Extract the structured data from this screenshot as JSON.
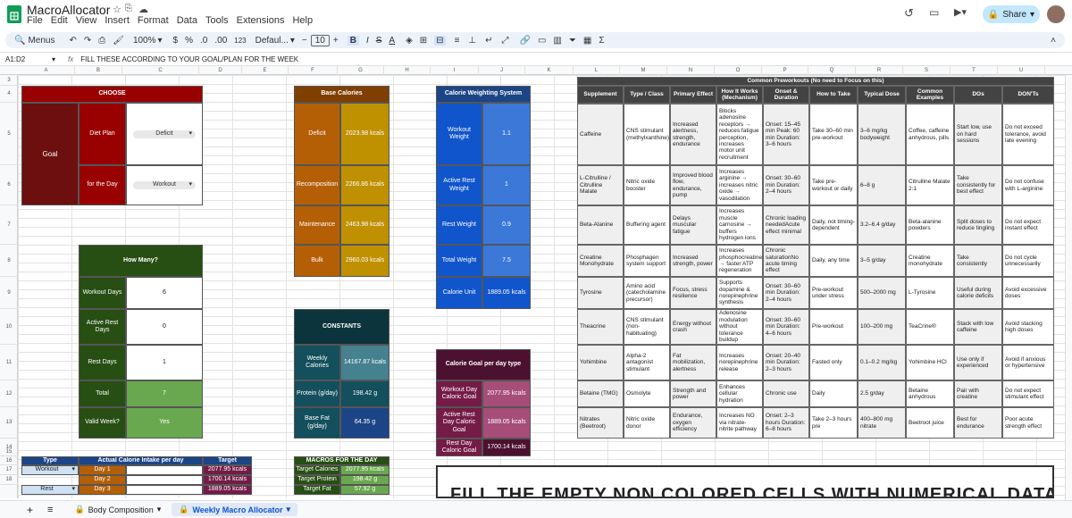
{
  "app": {
    "title": "MacroAllocator",
    "menus": [
      "File",
      "Edit",
      "View",
      "Insert",
      "Format",
      "Data",
      "Tools",
      "Extensions",
      "Help"
    ],
    "share": "Share"
  },
  "toolbar": {
    "menus_label": "Menus",
    "zoom": "100%",
    "currency": "$",
    "percent": "%",
    "dec_dec": ".0",
    "dec_inc": ".00",
    "num_fmt": "123",
    "font": "Defaul...",
    "font_size": "10"
  },
  "formula": {
    "cell_ref": "A1:D2",
    "fx": "fx",
    "content": "FILL THESE ACCORDING TO YOUR GOAL/PLAN FOR THE WEEK"
  },
  "columns": [
    "A",
    "B",
    "C",
    "D",
    "E",
    "F",
    "G",
    "H",
    "I",
    "J",
    "K",
    "L",
    "M",
    "N",
    "O",
    "P",
    "Q",
    "R",
    "S",
    "T",
    "U"
  ],
  "rows": [
    "3",
    "4",
    "5",
    "6",
    "7",
    "8",
    "9",
    "10",
    "11",
    "12",
    "13",
    "14",
    "15",
    "16",
    "17",
    "18"
  ],
  "choose": {
    "header": "CHOOSE",
    "goal": "Goal",
    "diet_plan": "Diet Plan",
    "diet_value": "Deficit",
    "for_day": "for the Day",
    "day_value": "Workout"
  },
  "howmany": {
    "header": "How Many?",
    "rows": [
      {
        "label": "Workout Days",
        "value": "6"
      },
      {
        "label": "Active Rest Days",
        "value": "0"
      },
      {
        "label": "Rest Days",
        "value": "1"
      },
      {
        "label": "Total",
        "value": "7"
      },
      {
        "label": "Valid Week?",
        "value": "Yes"
      }
    ]
  },
  "base": {
    "header": "Base Calories",
    "rows": [
      {
        "label": "Deficit",
        "value": "2023.98 kcals"
      },
      {
        "label": "Recomposition",
        "value": "2266.86 kcals"
      },
      {
        "label": "Maintenance",
        "value": "2463.98 kcals"
      },
      {
        "label": "Bulk",
        "value": "2960.03 kcals"
      }
    ]
  },
  "weighting": {
    "header": "Calorie Weighting System",
    "rows": [
      {
        "label": "Workout Weight",
        "value": "1.1"
      },
      {
        "label": "Active Rest Weight",
        "value": "1"
      },
      {
        "label": "Rest Weight",
        "value": "0.9"
      },
      {
        "label": "Total Weight",
        "value": "7.5"
      },
      {
        "label": "Calorie Unit",
        "value": "1889.05 kcals"
      }
    ]
  },
  "constants": {
    "header": "CONSTANTS",
    "rows": [
      {
        "label": "Weekly Calories",
        "value": "14167.87 kcals"
      },
      {
        "label": "Protein (g/day)",
        "value": "198.42 g"
      },
      {
        "label": "Base Fat (g/day)",
        "value": "64.35 g"
      }
    ]
  },
  "goal_per_day": {
    "header": "Calorie Goal per day type",
    "rows": [
      {
        "label": "Workout Day Caloric Goal",
        "value": "2077.95 kcals"
      },
      {
        "label": "Active Rest Day Caloric Goal",
        "value": "1889.05 kcals"
      },
      {
        "label": "Rest Day Caloric Goal",
        "value": "1700.14 kcals"
      }
    ]
  },
  "intake": {
    "headers": [
      "Type",
      "Actual Calorie Intake per day",
      "Target"
    ],
    "rows": [
      {
        "type": "Workout",
        "day": "Day 1",
        "target": "2077.95 kcals"
      },
      {
        "type": "Rest",
        "day": "Day 2",
        "target": "1700.14 kcals"
      },
      {
        "type": "Active Rest",
        "day": "Day 3",
        "target": "1889.05 kcals"
      }
    ]
  },
  "macros": {
    "header": "MACROS FOR THE DAY",
    "rows": [
      {
        "label": "Target Calories",
        "value": "2077.95 kcals"
      },
      {
        "label": "Target Protein",
        "value": "198.42 g"
      },
      {
        "label": "Target Fat",
        "value": "57.92 g"
      }
    ]
  },
  "preworkout": {
    "title": "Common Preworkouts (No need to Focus on this)",
    "headers": [
      "Supplement",
      "Type / Class",
      "Primary Effect",
      "How It Works (Mechanism)",
      "Onset & Duration",
      "How to Take",
      "Typical Dose",
      "Common Examples",
      "DOs",
      "DON'Ts"
    ],
    "rows": [
      [
        "Caffeine",
        "CNS stimulant (methylxanthine)",
        "Increased alertness, strength, endurance",
        "Blocks adenosine receptors → reduces fatigue perception, increases motor unit recruitment",
        "Onset: 15–45 min Peak: 60 min Duration: 3–6 hours",
        "Take 30–60 min pre-workout",
        "3–6 mg/kg bodyweight",
        "Coffee, caffeine anhydrous, pills",
        "Start low, use on hard sessions",
        "Do not exceed tolerance, avoid late evening"
      ],
      [
        "L-Citrulline / Citrulline Malate",
        "Nitric oxide booster",
        "Improved blood flow, endurance, pump",
        "Increases arginine → increases nitric oxide → vasodilation",
        "Onset: 30–60 min Duration: 2–4 hours",
        "Take pre-workout or daily",
        "6–8 g",
        "Citrulline Malate 2:1",
        "Take consistently for best effect",
        "Do not confuse with L-arginine"
      ],
      [
        "Beta-Alanine",
        "Buffering agent",
        "Delays muscular fatigue",
        "Increases muscle carnosine → buffers hydrogen ions",
        "Chronic loading neededAcute effect minimal",
        "Daily, not timing-dependent",
        "3.2–6.4 g/day",
        "Beta-alanine powders",
        "Split doses to reduce tingling",
        "Do not expect instant effect"
      ],
      [
        "Creatine Monohydrate",
        "Phosphagen system support",
        "Increased strength, power",
        "Increases phosphocreatine → faster ATP regeneration",
        "Chronic saturationNo acute timing effect",
        "Daily, any time",
        "3–5 g/day",
        "Creatine monohydrate",
        "Take consistently",
        "Do not cycle unnecessarily"
      ],
      [
        "Tyrosine",
        "Amino acid (catecholamine precursor)",
        "Focus, stress resilience",
        "Supports dopamine & norepinephrine synthesis",
        "Onset: 30–60 min Duration: 2–4 hours",
        "Pre-workout under stress",
        "500–2000 mg",
        "L-Tyrosine",
        "Useful during calorie deficits",
        "Avoid excessive doses"
      ],
      [
        "Theacrine",
        "CNS stimulant (non-habituating)",
        "Energy without crash",
        "Adenosine modulation without tolerance buildup",
        "Onset: 30–60 min Duration: 4–6 hours",
        "Pre-workout",
        "100–200 mg",
        "TeaCrine®",
        "Stack with low caffeine",
        "Avoid stacking high doses"
      ],
      [
        "Yohimbine",
        "Alpha-2 antagonist stimulant",
        "Fat mobilization, alertness",
        "Increases norepinephrine release",
        "Onset: 20–40 min Duration: 2–3 hours",
        "Fasted only",
        "0.1–0.2 mg/kg",
        "Yohimbine HCl",
        "Use only if experienced",
        "Avoid if anxious or hypertensive"
      ],
      [
        "Betaine (TMG)",
        "Osmolyte",
        "Strength and power",
        "Enhances cellular hydration",
        "Chronic use",
        "Daily",
        "2.5 g/day",
        "Betaine anhydrous",
        "Pair with creatine",
        "Do not expect stimulant effect"
      ],
      [
        "Nitrates (Beetroot)",
        "Nitric oxide donor",
        "Endurance, oxygen efficiency",
        "Increases NO via nitrate-nitrite pathway",
        "Onset: 2–3 hours Duration: 6–8 hours",
        "Take 2–3 hours pre",
        "400–800 mg nitrate",
        "Beetroot juice",
        "Best for endurance",
        "Poor acute strength effect"
      ]
    ]
  },
  "banner": "FILL THE EMPTY NON COLORED CELLS WITH NUMERICAL DATA",
  "sheets": [
    "Body Composition",
    "Weekly Macro Allocator"
  ],
  "colors": {
    "goal": "#6d0f0f",
    "choose": "#990000",
    "howmany": "#274e13",
    "green": "#6aa84f",
    "base": "#b45f06",
    "gold": "#bf9000",
    "blue": "#1155cc",
    "bright_blue": "#3c78d8",
    "teal": "#134f5c",
    "cyan": "#45818e",
    "maroon": "#4c1130",
    "pink": "#a64d79",
    "navy": "#1c4587"
  }
}
